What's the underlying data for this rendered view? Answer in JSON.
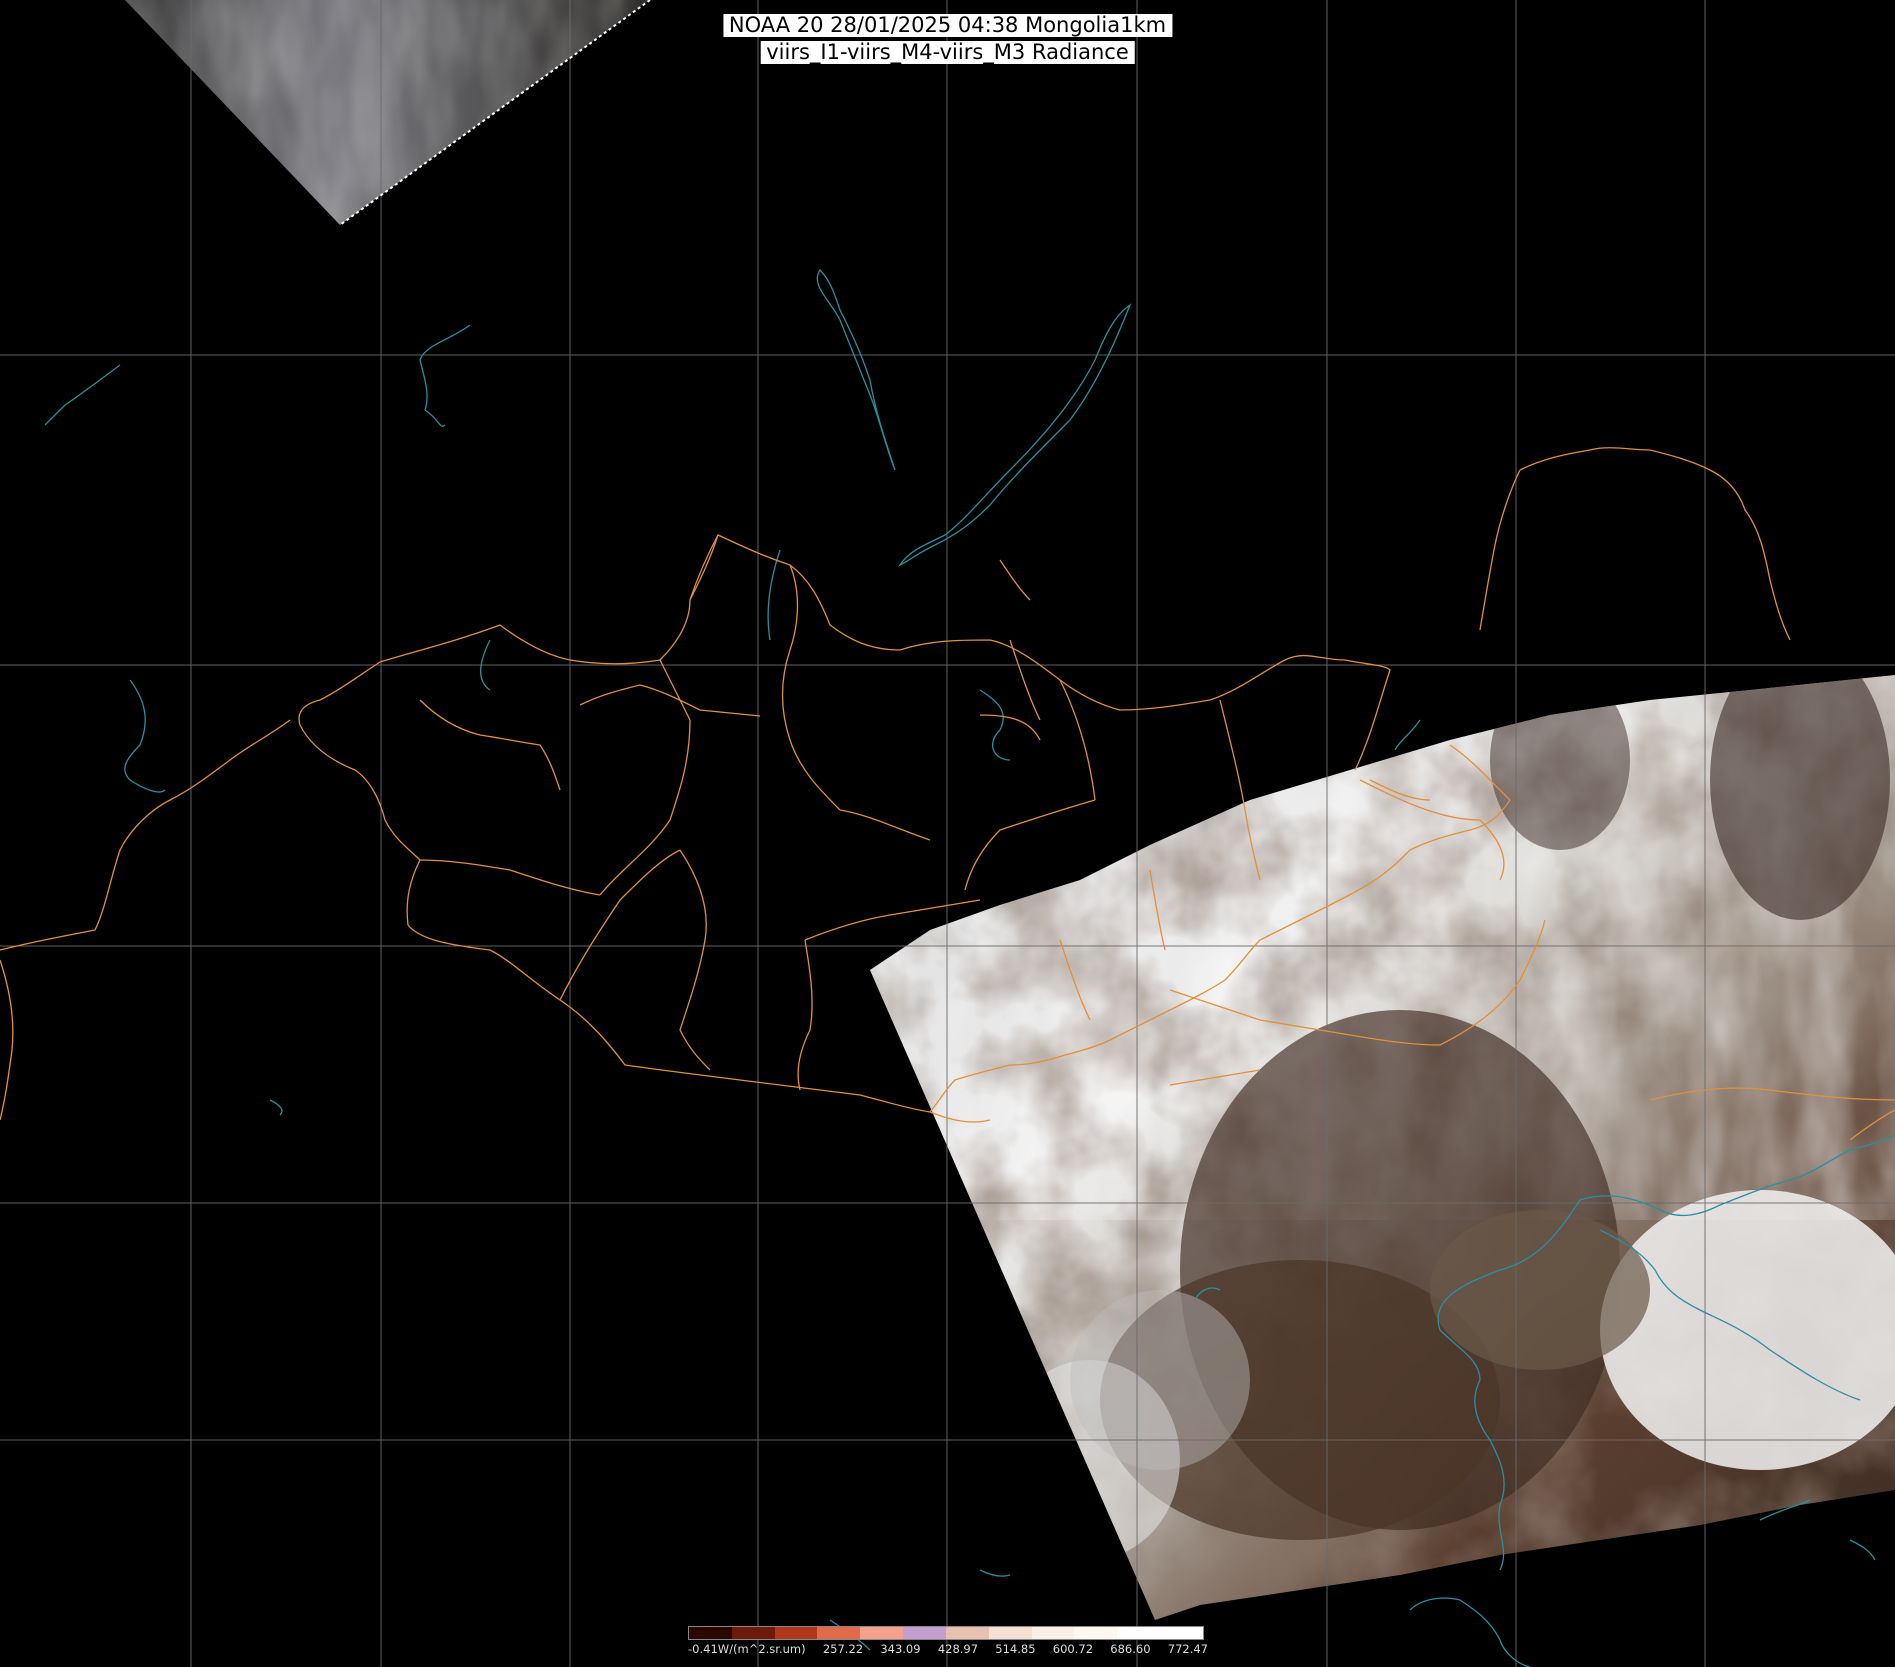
{
  "header": {
    "line1": "NOAA 20 28/01/2025 04:38 Mongolia1km",
    "line2": "viirs_I1-viirs_M4-viirs_M3 Radiance"
  },
  "legend": {
    "unit_label": "-0.41W/(m^2.sr.um)",
    "ticks": [
      "257.22",
      "343.09",
      "428.97",
      "514.85",
      "600.72",
      "686.60",
      "772.47"
    ],
    "colors": [
      "#2a0800",
      "#6e1a08",
      "#b3351c",
      "#e06a4a",
      "#f4a08c",
      "#c39fd0",
      "#e8c0b0",
      "#f6e0d4",
      "#fbeee6",
      "#fff8f0",
      "#ffffff",
      "#ffffff"
    ]
  },
  "map": {
    "border_color": "#e0913a",
    "coast_color": "#2a8fa0",
    "grid_color": "#6a6a6a"
  }
}
